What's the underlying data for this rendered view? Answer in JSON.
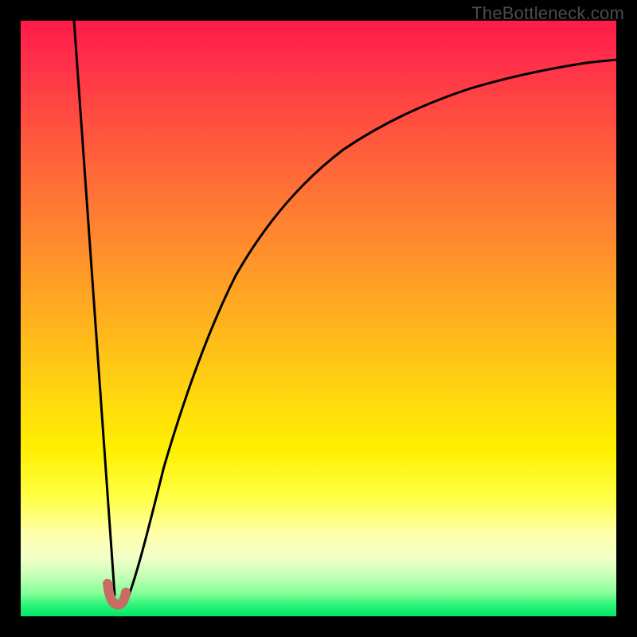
{
  "attribution": "TheBottleneck.com",
  "colors": {
    "frame": "#000000",
    "curve": "#000000",
    "marker": "#c96a63",
    "gradient_stops": [
      "#ff1a4a",
      "#ff2d4a",
      "#ff4642",
      "#ff6a38",
      "#ff8d2d",
      "#ffb01e",
      "#ffd410",
      "#fff000",
      "#ffff44",
      "#ffffaa",
      "#f4ffc8",
      "#c8ffb8",
      "#8aff9a",
      "#30f57a",
      "#00e76a"
    ]
  },
  "chart_data": {
    "type": "line",
    "title": "",
    "xlabel": "",
    "ylabel": "",
    "xlim": [
      0,
      100
    ],
    "ylim": [
      0,
      100
    ],
    "grid": false,
    "series": [
      {
        "name": "left-descent",
        "x": [
          9.0,
          15.8
        ],
        "values": [
          100,
          3.5
        ]
      },
      {
        "name": "right-ascent",
        "x": [
          17.6,
          20,
          23,
          26,
          30,
          34,
          38,
          42,
          46,
          50,
          55,
          60,
          65,
          70,
          75,
          80,
          85,
          90,
          95,
          100
        ],
        "values": [
          2.1,
          8,
          18,
          28,
          39,
          49,
          56,
          62,
          67.5,
          72,
          76.5,
          80,
          83,
          85.3,
          87.3,
          89,
          90.4,
          91.6,
          92.6,
          93.4
        ]
      },
      {
        "name": "valley-marker",
        "x": [
          14.6,
          15.1,
          15.8,
          16.6,
          17.3,
          17.7,
          17.8
        ],
        "values": [
          5.4,
          3.3,
          2.2,
          1.9,
          2.0,
          2.8,
          4.1
        ]
      }
    ],
    "annotations": []
  }
}
